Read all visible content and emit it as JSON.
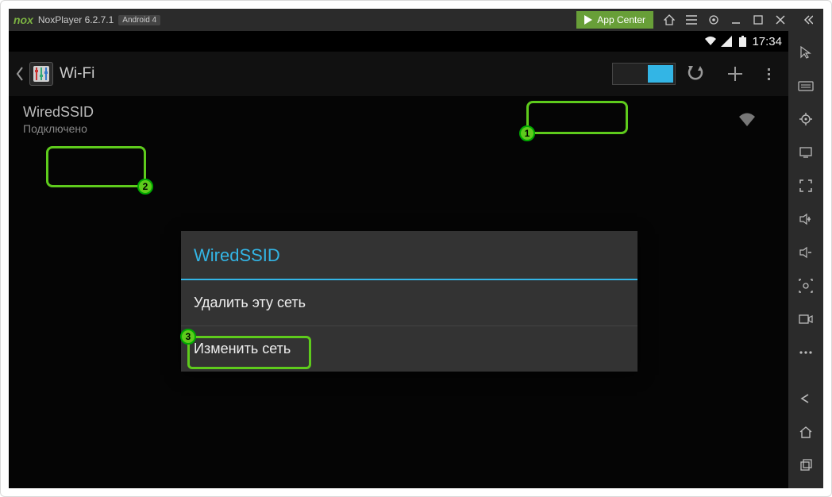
{
  "titlebar": {
    "logo_text": "nox",
    "app_name": "NoxPlayer 6.2.7.1",
    "android_badge": "Android 4",
    "app_center": "App Center"
  },
  "status": {
    "time": "17:34"
  },
  "wifi": {
    "title": "Wi-Fi",
    "network": {
      "ssid": "WiredSSID",
      "status": "Подключено"
    }
  },
  "dialog": {
    "title": "WiredSSID",
    "forget": "Удалить эту сеть",
    "modify": "Изменить сеть"
  },
  "callouts": {
    "one": "1",
    "two": "2",
    "three": "3"
  }
}
